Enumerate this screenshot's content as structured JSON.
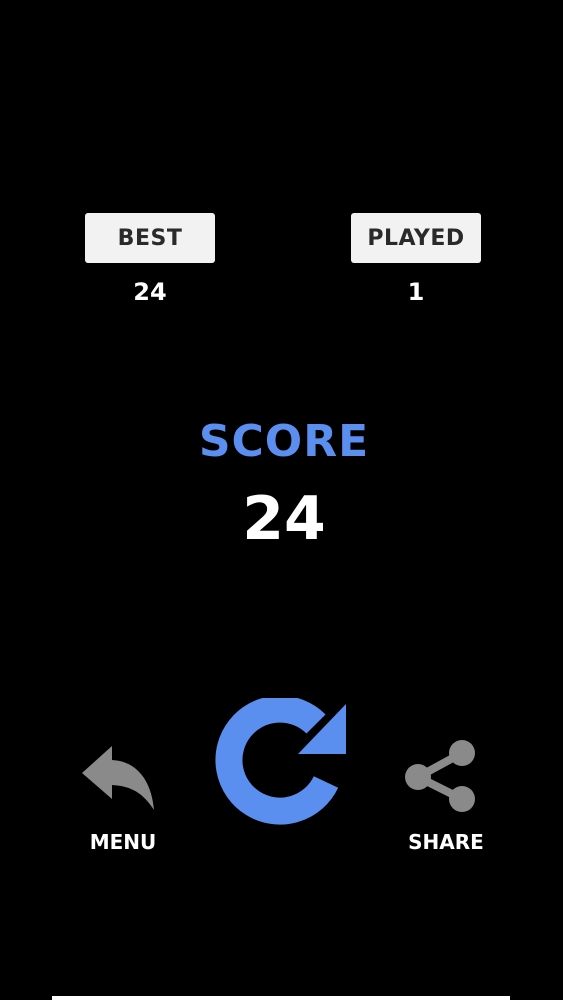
{
  "stats": {
    "best_label": "BEST",
    "best_value": "24",
    "played_label": "PLAYED",
    "played_value": "1"
  },
  "score": {
    "label": "SCORE",
    "value": "24"
  },
  "actions": {
    "menu_label": "MENU",
    "share_label": "SHARE",
    "menu_icon": "back-arrow-icon",
    "restart_icon": "restart-icon",
    "share_icon": "share-icon"
  },
  "colors": {
    "background": "#000000",
    "accent": "#5a8ff0",
    "icon_gray": "#8a8a8a",
    "box_bg": "#f2f2f2",
    "box_text": "#2a2a2a"
  }
}
